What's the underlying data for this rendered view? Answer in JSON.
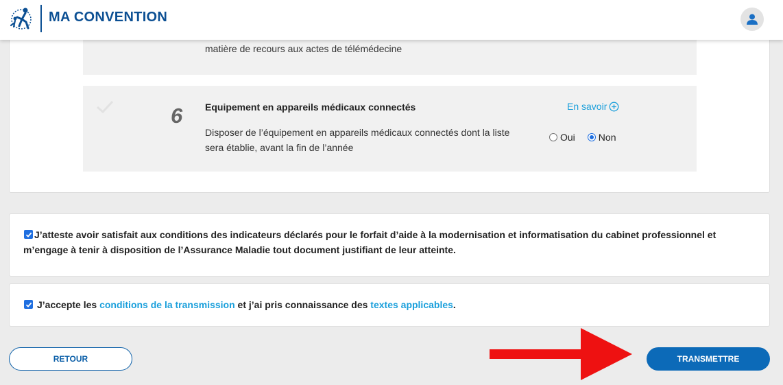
{
  "header": {
    "brand": "MA CONVENTION",
    "logo_icon": "assurance-maladie-logo-icon",
    "user_icon": "user-icon",
    "brand_color": "#0b4f93"
  },
  "indicators": {
    "previous_item_desc": "matière de recours aux actes de télémédecine",
    "item6": {
      "number": "6",
      "title": "Equipement en appareils médicaux connectés",
      "description": "Disposer de l’équipement en appareils médicaux connectés dont la liste sera établie, avant la fin de l’année",
      "learn_more": "En savoir",
      "options": [
        {
          "label": "Oui",
          "selected": false
        },
        {
          "label": "Non",
          "selected": true
        }
      ]
    }
  },
  "attestation": {
    "checked": true,
    "text": "J’atteste avoir satisfait aux conditions des indicateurs déclarés pour le forfait d’aide à la modernisation et informatisation du cabinet professionnel et m’engage à tenir à disposition de l’Assurance Maladie tout document justifiant de leur atteinte."
  },
  "acceptance": {
    "checked": true,
    "prefix": "J’accepte les ",
    "link1": "conditions de la transmission",
    "middle": " et j’ai pris connaissance des ",
    "link2": "textes applicables",
    "suffix": "."
  },
  "buttons": {
    "back": "RETOUR",
    "submit": "TRANSMETTRE"
  },
  "colors": {
    "link": "#1a9fdb",
    "primary_button": "#0c6ab8",
    "arrow": "#ee1111"
  }
}
